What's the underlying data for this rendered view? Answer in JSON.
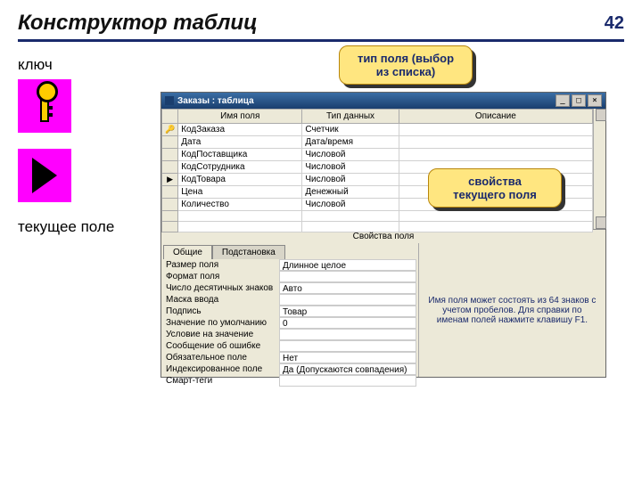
{
  "slide": {
    "title": "Конструктор таблиц",
    "number": "42",
    "labels": {
      "key": "ключ",
      "current_field": "текущее поле"
    },
    "callouts": {
      "type_select": "тип поля (выбор из списка)",
      "properties": "свойства текущего поля"
    }
  },
  "window": {
    "title": "Заказы : таблица",
    "columns": [
      "Имя поля",
      "Тип данных",
      "Описание"
    ],
    "key_marker": "🔑",
    "current_marker": "▶",
    "rows": [
      {
        "name": "КодЗаказа",
        "type": "Счетчик",
        "desc": "",
        "key": true
      },
      {
        "name": "Дата",
        "type": "Дата/время",
        "desc": ""
      },
      {
        "name": "КодПоставщика",
        "type": "Числовой",
        "desc": ""
      },
      {
        "name": "КодСотрудника",
        "type": "Числовой",
        "desc": ""
      },
      {
        "name": "КодТовара",
        "type": "Числовой",
        "desc": "",
        "current": true
      },
      {
        "name": "Цена",
        "type": "Денежный",
        "desc": ""
      },
      {
        "name": "Количество",
        "type": "Числовой",
        "desc": ""
      }
    ],
    "properties_header": "Свойства поля",
    "tabs": {
      "general": "Общие",
      "lookup": "Подстановка"
    },
    "properties": [
      {
        "label": "Размер поля",
        "value": "Длинное целое"
      },
      {
        "label": "Формат поля",
        "value": ""
      },
      {
        "label": "Число десятичных знаков",
        "value": "Авто"
      },
      {
        "label": "Маска ввода",
        "value": ""
      },
      {
        "label": "Подпись",
        "value": "Товар"
      },
      {
        "label": "Значение по умолчанию",
        "value": "0"
      },
      {
        "label": "Условие на значение",
        "value": ""
      },
      {
        "label": "Сообщение об ошибке",
        "value": ""
      },
      {
        "label": "Обязательное поле",
        "value": "Нет"
      },
      {
        "label": "Индексированное поле",
        "value": "Да (Допускаются совпадения)"
      },
      {
        "label": "Смарт-теги",
        "value": ""
      }
    ],
    "hint": "Имя поля может состоять из 64 знаков с учетом пробелов. Для справки по именам полей нажмите клавишу F1."
  }
}
